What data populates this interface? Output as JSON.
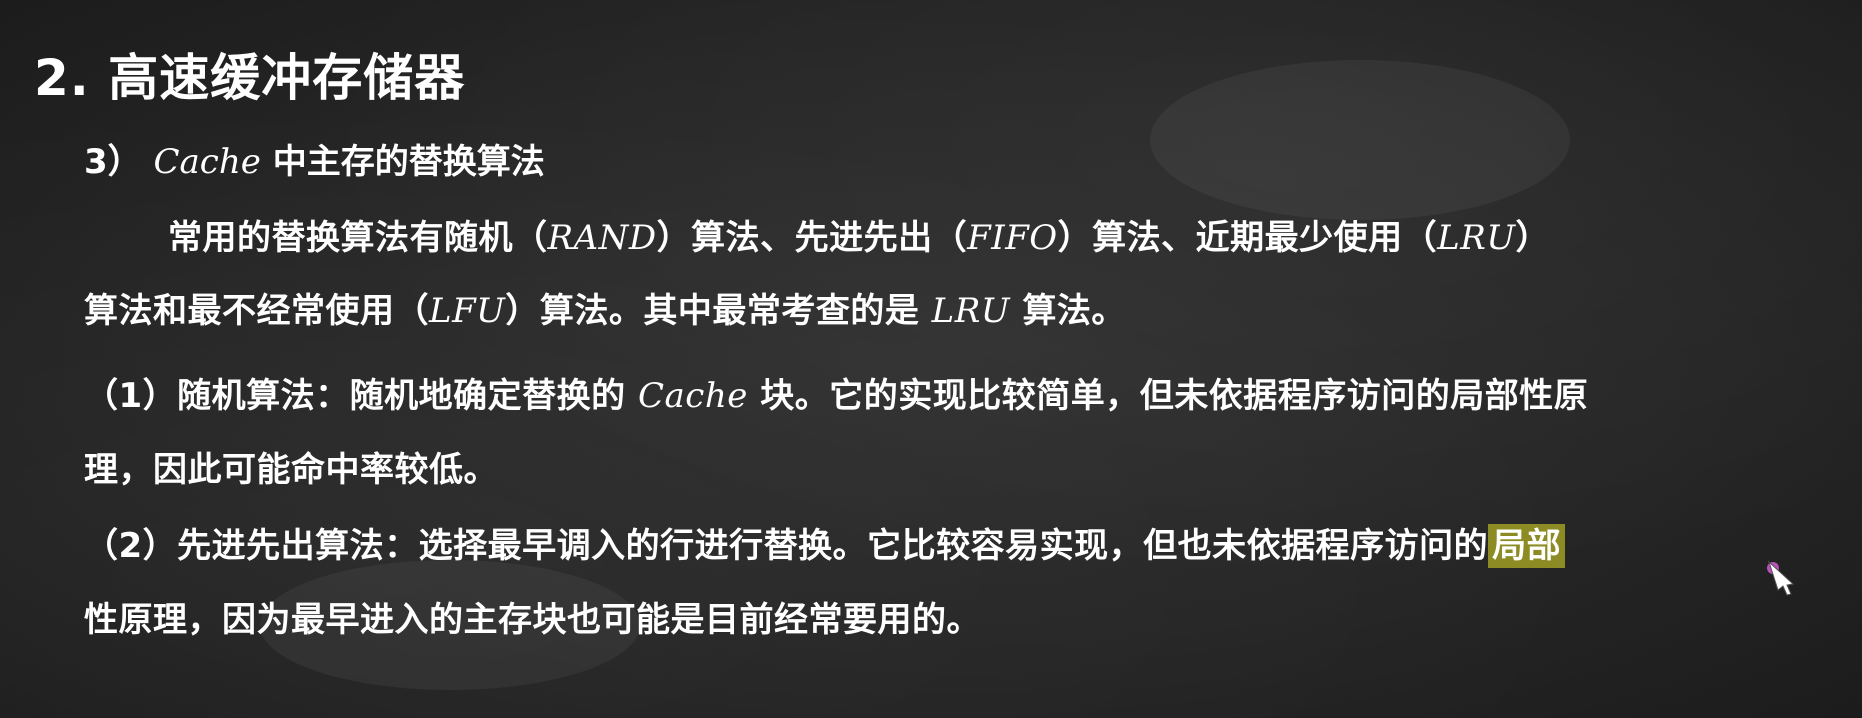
{
  "slide": {
    "title": "2. 高速缓冲存储器",
    "subtitle": {
      "number": "3）",
      "cache_word": "Cache",
      "text": " 中主存的替换算法"
    },
    "intro_line1": {
      "p1": "常用的替换算法有随机（",
      "rand": "RAND",
      "p2": "）算法、先进先出（",
      "fifo": "FIFO",
      "p3": "）算法、近期最少使用（",
      "lru": "LRU",
      "p4": "）"
    },
    "intro_line2": {
      "p1": "算法和最不经常使用（",
      "lfu": "LFU",
      "p2": "）算法。其中最常考查的是 ",
      "lru": "LRU",
      "p3": " 算法。"
    },
    "item1_line1": {
      "p1": "（1）随机算法：随机地确定替换的 ",
      "cache": "Cache",
      "p2": " 块。它的实现比较简单，但未依据程序访问的局部性原"
    },
    "item1_line2": "理，因此可能命中率较低。",
    "item2_line1": {
      "p1": "（2）先进先出算法：选择最早调入的行进行替换。它比较容易实现，但也未依据程序访问的",
      "highlighted": "局部"
    },
    "item2_line2": "性原理，因为最早进入的主存块也可能是目前经常要用的。"
  },
  "colors": {
    "background": "#262626",
    "text": "#ffffff",
    "highlight": "#8d8c24"
  },
  "icons": {
    "cursor": "pen-cursor-icon"
  }
}
